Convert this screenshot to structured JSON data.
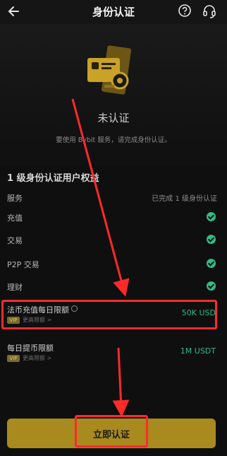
{
  "header": {
    "title": "身份认证",
    "back_icon": "arrow-left-icon",
    "help_icon": "question-circle-icon",
    "support_icon": "headset-icon"
  },
  "hero": {
    "status": "未认证",
    "description": "要使用 Bybit 服务，请完成身份认证。",
    "illustration": "id-card-icon"
  },
  "benefits": {
    "title": "1 级身份认证用户权益",
    "service_header": {
      "label": "服务",
      "value": "已完成 1 级身份认证"
    },
    "items": [
      {
        "label": "充值",
        "icon": "check-circle-icon"
      },
      {
        "label": "交易",
        "icon": "check-circle-icon"
      },
      {
        "label": "P2P 交易",
        "icon": "check-circle-icon"
      },
      {
        "label": "理财",
        "icon": "check-circle-icon"
      }
    ]
  },
  "limits": [
    {
      "label": "法币充值每日限额",
      "badge": "VIP",
      "sub": "更高限额 >",
      "value": "50K USD"
    },
    {
      "label": "每日提币限额",
      "badge": "VIP",
      "sub": "更高限额 >",
      "value": "1M USDT"
    }
  ],
  "cta": {
    "label": "立即认证"
  },
  "colors": {
    "accent": "#a98a1e",
    "success": "#2ebd85",
    "annotation": "#ff2a2a",
    "background": "#0f0f0f"
  }
}
